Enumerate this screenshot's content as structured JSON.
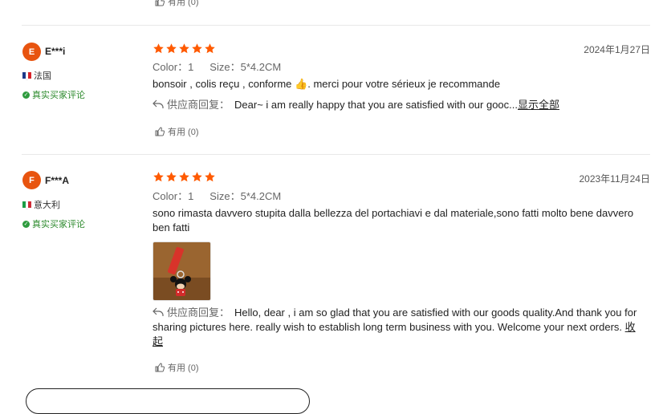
{
  "helpful_label": "有用 (0)",
  "reviews": [
    {
      "avatar_letter": "E",
      "username": "E***i",
      "country": "法国",
      "verified": "真实买家评论",
      "date": "2024年1月27日",
      "color": "Color：1",
      "size": "Size：5*4.2CM",
      "content_before_emoji": "bonsoir , colis reçu , conforme ",
      "emoji": "👍",
      "content_after_emoji": ". merci pour votre sérieux je recommande",
      "reply_label": "供应商回复：",
      "reply_text": "Dear~ i am really happy that you are satisfied with our gooc...",
      "reply_toggle": "显示全部",
      "helpful": "有用 (0)"
    },
    {
      "avatar_letter": "F",
      "username": "F***A",
      "country": "意大利",
      "verified": "真实买家评论",
      "date": "2023年11月24日",
      "color": "Color：1",
      "size": "Size：5*4.2CM",
      "content": "sono rimasta davvero stupita dalla bellezza del portachiavi e dal materiale,sono fatti molto bene davvero ben fatti",
      "reply_label": "供应商回复：",
      "reply_text": "Hello, dear , i am so glad that you are satisfied with our goods quality.And thank you for sharing pictures here. really wish to establish long term business with you. Welcome your next orders. ",
      "reply_toggle": "收起",
      "helpful": "有用 (0)"
    }
  ],
  "colors": {
    "star": "#ff5a00",
    "avatar": "#e8540f",
    "verified": "#2e8b2e"
  },
  "icons": [
    "thumbs-up-icon",
    "reply-arrow-icon",
    "star-icon",
    "verified-check-icon",
    "flag-icon"
  ]
}
